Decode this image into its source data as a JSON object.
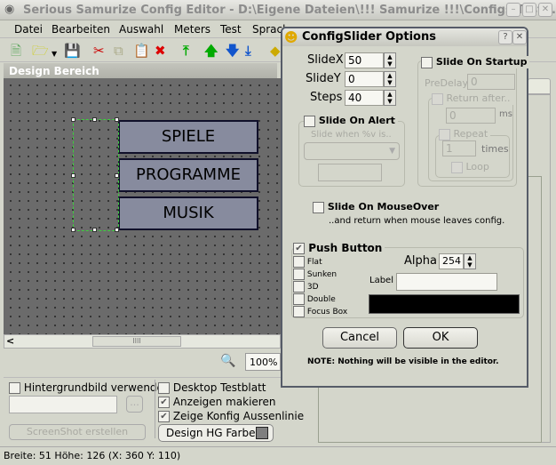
{
  "window": {
    "title": "Serious Samurize Config Editor - D:\\Eigene Dateien\\!!! Samurize !!!\\Configs\\Test\\..."
  },
  "menu": [
    "Datei",
    "Bearbeiten",
    "Auswahl",
    "Meters",
    "Test",
    "Sprache"
  ],
  "design": {
    "header": "Design Bereich",
    "buttons": [
      "SPIELE",
      "PROGRAMME",
      "MUSIK"
    ],
    "zoom": "100%",
    "scroll_grip": "IIII"
  },
  "bottom": {
    "hintergrund": "Hintergrundbild verwenden",
    "browse": "...",
    "screenshot": "ScreenShot erstellen",
    "desktop": "Desktop Testblatt",
    "anzeigen": "Anzeigen makieren",
    "zeige": "Zeige Konfig Aussenlinie",
    "farbe": "Design HG Farbe...",
    "farbe_color": "#7f7f7f"
  },
  "status": "Breite: 51  Höhe: 126  (X: 360  Y: 110)",
  "dialog": {
    "title": "ConfigSlider Options",
    "slidex_label": "SlideX",
    "slidex": "50",
    "slidey_label": "SlideY",
    "slidey": "0",
    "steps_label": "Steps",
    "steps": "40",
    "slide_alert": "Slide On Alert",
    "slide_when": "Slide when %v is..",
    "slide_startup": "Slide On Startup",
    "predelay_label": "PreDelay",
    "predelay": "0",
    "return_after": "Return after..",
    "return_ms": "0",
    "ms": "ms",
    "repeat": "Repeat",
    "repeat_times": "1",
    "times": "times",
    "loop": "Loop",
    "mouseover": "Slide On MouseOver",
    "mouseover_note": "..and return when mouse leaves config.",
    "push_button": "Push Button",
    "options": [
      "Flat",
      "Sunken",
      "3D",
      "Double",
      "Focus Box"
    ],
    "alpha_label": "Alpha",
    "alpha": "254",
    "label_label": "Label",
    "label_value": "",
    "color": "#000000",
    "cancel": "Cancel",
    "ok": "OK",
    "note": "NOTE: Nothing will be visible in the editor."
  }
}
